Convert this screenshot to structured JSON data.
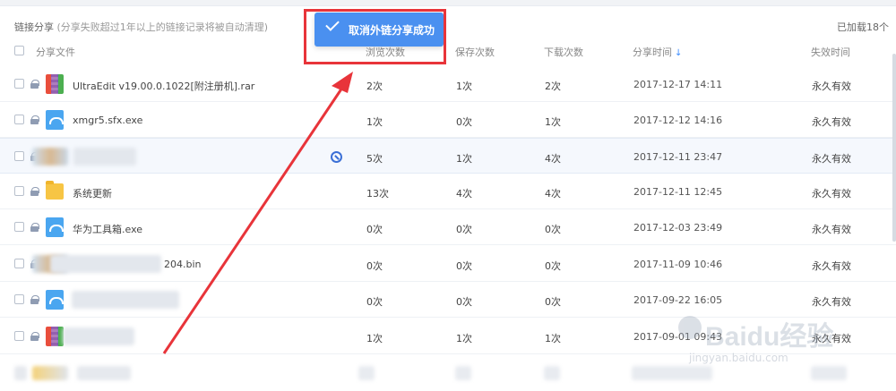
{
  "header": {
    "title": "链接分享",
    "note": "(分享失败超过1年以上的链接记录将被自动清理)",
    "loaded_count": "已加载18个"
  },
  "columns": {
    "file": "分享文件",
    "views": "浏览次数",
    "saves": "保存次数",
    "downloads": "下载次数",
    "share_time": "分享时间",
    "expire": "失效时间"
  },
  "toast": {
    "message": "取消外链分享成功"
  },
  "rows": [
    {
      "name": "UltraEdit v19.00.0.1022[附注册机].rar",
      "icon": "rar-archive-icon",
      "views": "2次",
      "saves": "1次",
      "downloads": "2次",
      "time": "2017-12-17 14:11",
      "expire": "永久有效"
    },
    {
      "name": "xmgr5.sfx.exe",
      "icon": "exe-file-icon",
      "views": "1次",
      "saves": "0次",
      "downloads": "1次",
      "time": "2017-12-12 14:16",
      "expire": "永久有效"
    },
    {
      "name": "",
      "icon": "blurred-file-icon",
      "views": "5次",
      "saves": "1次",
      "downloads": "4次",
      "time": "2017-12-11 23:47",
      "expire": "永久有效"
    },
    {
      "name": "系统更新",
      "icon": "folder-icon",
      "views": "13次",
      "saves": "4次",
      "downloads": "4次",
      "time": "2017-12-11 12:45",
      "expire": "永久有效"
    },
    {
      "name": "华为工具箱.exe",
      "icon": "exe-file-icon",
      "views": "0次",
      "saves": "0次",
      "downloads": "0次",
      "time": "2017-12-03 23:49",
      "expire": "永久有效"
    },
    {
      "name": "204.bin",
      "icon": "blurred-file-icon",
      "views": "0次",
      "saves": "0次",
      "downloads": "0次",
      "time": "2017-11-09 10:46",
      "expire": "永久有效"
    },
    {
      "name": "",
      "icon": "exe-file-icon",
      "views": "0次",
      "saves": "0次",
      "downloads": "0次",
      "time": "2017-09-22 16:05",
      "expire": "永久有效"
    },
    {
      "name": "",
      "icon": "rar-archive-icon",
      "views": "1次",
      "saves": "1次",
      "downloads": "1次",
      "time": "2017-09-01 09:43",
      "expire": "永久有效"
    }
  ],
  "watermark": {
    "brand": "Baidu经验",
    "url": "jingyan.baidu.com"
  },
  "colors": {
    "accent": "#4a90f0",
    "highlight": "#e8343a"
  }
}
